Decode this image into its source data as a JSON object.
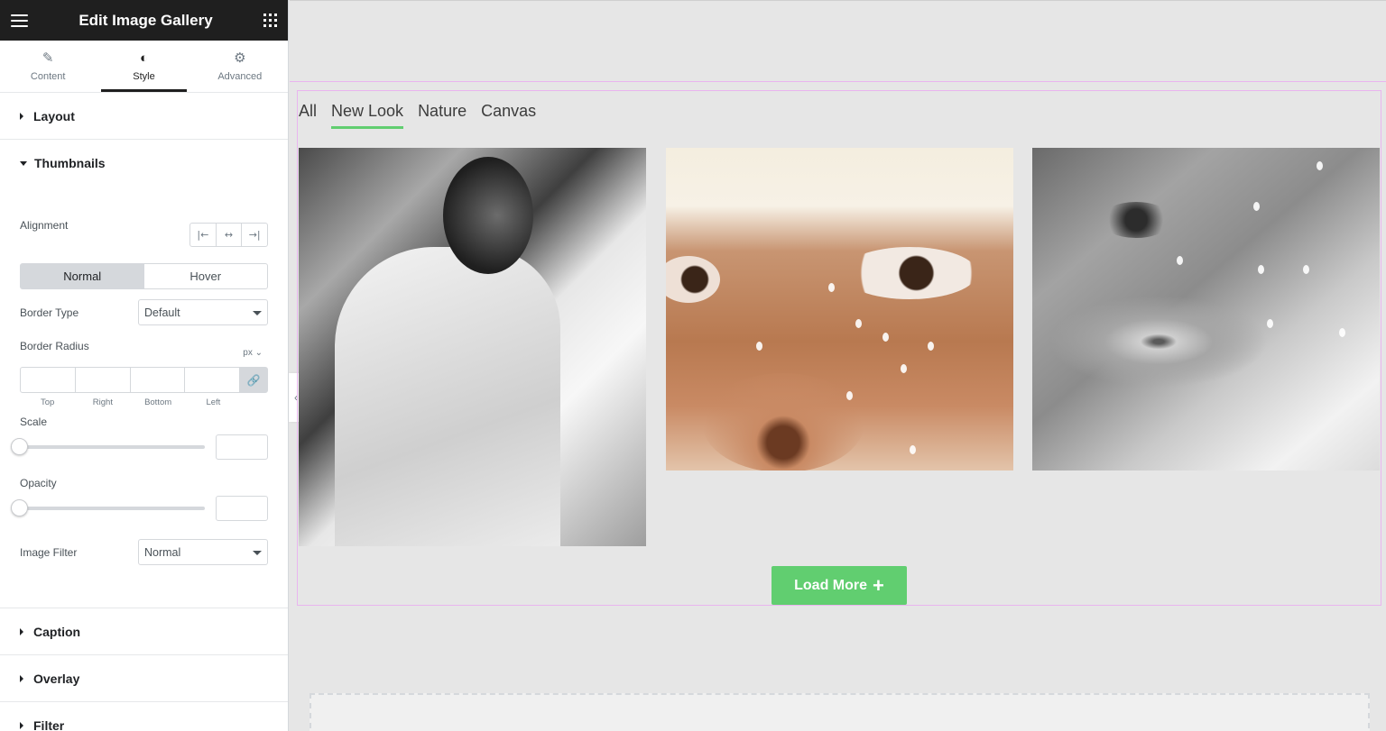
{
  "panel": {
    "title": "Edit Image Gallery",
    "tabs": [
      {
        "label": "Content",
        "icon": "pencil-icon"
      },
      {
        "label": "Style",
        "icon": "contrast-icon"
      },
      {
        "label": "Advanced",
        "icon": "gear-icon"
      }
    ],
    "active_tab": "Style",
    "sections": {
      "layout": "Layout",
      "thumbnails": "Thumbnails",
      "caption": "Caption",
      "overlay": "Overlay",
      "filter": "Filter"
    },
    "thumbnails": {
      "alignment_label": "Alignment",
      "state_normal": "Normal",
      "state_hover": "Hover",
      "border_type_label": "Border Type",
      "border_type_value": "Default",
      "border_radius_label": "Border Radius",
      "unit": "px",
      "dims": [
        "Top",
        "Right",
        "Bottom",
        "Left"
      ],
      "scale_label": "Scale",
      "opacity_label": "Opacity",
      "image_filter_label": "Image Filter",
      "image_filter_value": "Normal"
    }
  },
  "gallery": {
    "filters": [
      "All",
      "New Look",
      "Nature",
      "Canvas"
    ],
    "active_filter": "New Look",
    "load_more_label": "Load More"
  },
  "colors": {
    "accent": "#61ce70",
    "header_bg": "#1f1f1f",
    "widget_outline": "#e9b5ef"
  }
}
